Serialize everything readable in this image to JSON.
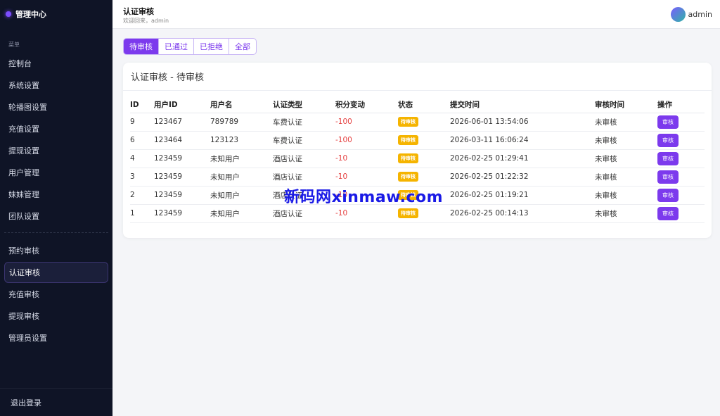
{
  "sidebar": {
    "brand": "管理中心",
    "menu_heading": "菜单",
    "items": [
      {
        "label": "控制台"
      },
      {
        "label": "系统设置"
      },
      {
        "label": "轮播图设置"
      },
      {
        "label": "充值设置"
      },
      {
        "label": "提现设置"
      },
      {
        "label": "用户管理"
      },
      {
        "label": "妹妹管理"
      },
      {
        "label": "团队设置"
      }
    ],
    "items2": [
      {
        "label": "预约审核"
      },
      {
        "label": "认证审核",
        "active": true
      },
      {
        "label": "充值审核"
      },
      {
        "label": "提现审核"
      },
      {
        "label": "管理员设置"
      }
    ],
    "logout": "退出登录"
  },
  "header": {
    "title": "认证审核",
    "subtitle": "欢迎回来，admin",
    "user": "admin",
    "avatar_colors": [
      "#7b5cff",
      "#2fb5a6"
    ]
  },
  "tabs": [
    {
      "label": "待审核",
      "active": true
    },
    {
      "label": "已通过"
    },
    {
      "label": "已拒绝"
    },
    {
      "label": "全部"
    }
  ],
  "card": {
    "title": "认证审核 - 待审核"
  },
  "table": {
    "columns": [
      "ID",
      "用户ID",
      "用户名",
      "认证类型",
      "积分变动",
      "状态",
      "提交时间",
      "审核时间",
      "操作"
    ],
    "rows": [
      {
        "id": "9",
        "user_id": "123467",
        "username": "789789",
        "type": "车费认证",
        "points": "-100",
        "status": "待审核",
        "submitted": "2026-06-01 13:54:06",
        "reviewed": "未审核",
        "action": "审核"
      },
      {
        "id": "6",
        "user_id": "123464",
        "username": "123123",
        "type": "车费认证",
        "points": "-100",
        "status": "待审核",
        "submitted": "2026-03-11 16:06:24",
        "reviewed": "未审核",
        "action": "审核"
      },
      {
        "id": "4",
        "user_id": "123459",
        "username": "未知用户",
        "type": "酒店认证",
        "points": "-10",
        "status": "待审核",
        "submitted": "2026-02-25 01:29:41",
        "reviewed": "未审核",
        "action": "审核"
      },
      {
        "id": "3",
        "user_id": "123459",
        "username": "未知用户",
        "type": "酒店认证",
        "points": "-10",
        "status": "待审核",
        "submitted": "2026-02-25 01:22:32",
        "reviewed": "未审核",
        "action": "审核"
      },
      {
        "id": "2",
        "user_id": "123459",
        "username": "未知用户",
        "type": "酒店认证",
        "points": "-10",
        "status": "待审核",
        "submitted": "2026-02-25 01:19:21",
        "reviewed": "未审核",
        "action": "审核"
      },
      {
        "id": "1",
        "user_id": "123459",
        "username": "未知用户",
        "type": "酒店认证",
        "points": "-10",
        "status": "待审核",
        "submitted": "2026-02-25 00:14:13",
        "reviewed": "未审核",
        "action": "审核"
      }
    ]
  },
  "watermark": "新码网xinmaw.com",
  "colors": {
    "sidebar_bg": "#0f1426",
    "accent": "#7c3aed",
    "badge_pending": "#f5b400",
    "negative": "#e53e3e"
  }
}
